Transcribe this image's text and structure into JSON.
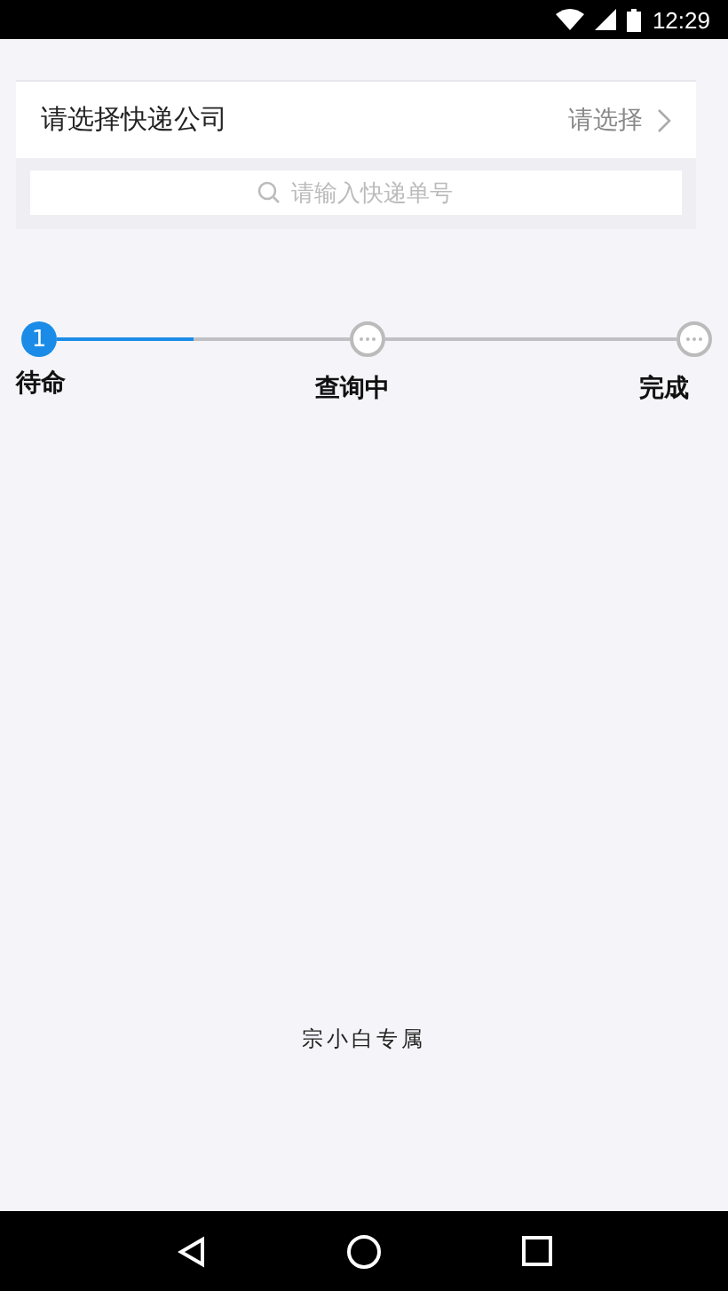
{
  "status_bar": {
    "time": "12:29"
  },
  "company_picker": {
    "label": "请选择快递公司",
    "value": "请选择"
  },
  "search": {
    "placeholder": "请输入快递单号"
  },
  "steps": [
    {
      "label": "待命",
      "selected": true,
      "number": "1"
    },
    {
      "label": "查询中",
      "selected": false
    },
    {
      "label": "完成",
      "selected": false
    }
  ],
  "connectors": [
    {
      "level": 0.47
    },
    {
      "level": 0
    }
  ],
  "footer": "宗小白专属"
}
